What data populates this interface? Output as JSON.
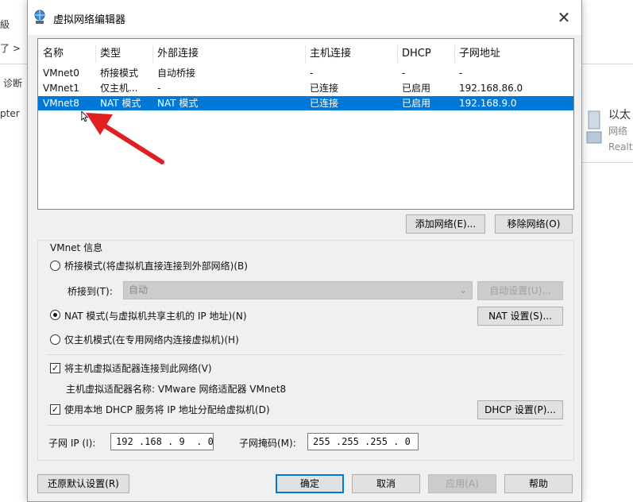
{
  "background": {
    "frag1": "級",
    "frag2": "了 >",
    "frag3": "诊断",
    "frag4": "pter",
    "frag5": "以太",
    "frag6": "网络",
    "frag7": "Realt"
  },
  "window": {
    "title": "虚拟网络编辑器",
    "close": "✕"
  },
  "network_list": {
    "columns": [
      "名称",
      "类型",
      "外部连接",
      "主机连接",
      "DHCP",
      "子网地址"
    ],
    "rows": [
      [
        "VMnet0",
        "桥接模式",
        "自动桥接",
        "-",
        "-",
        "-"
      ],
      [
        "VMnet1",
        "仅主机...",
        "-",
        "已连接",
        "已启用",
        "192.168.86.0"
      ],
      [
        "VMnet8",
        "NAT 模式",
        "NAT 模式",
        "已连接",
        "已启用",
        "192.168.9.0"
      ]
    ],
    "selected_index": 2
  },
  "list_buttons": {
    "add": "添加网络(E)...",
    "remove": "移除网络(O)"
  },
  "vmnet_info": {
    "title": "VMnet 信息",
    "bridged_label": "桥接模式(将虚拟机直接连接到外部网络)(B)",
    "bridge_to_label": "桥接到(T):",
    "bridge_to_value": "自动",
    "auto_settings": "自动设置(U)...",
    "nat_label": "NAT 模式(与虚拟机共享主机的 IP 地址)(N)",
    "nat_settings": "NAT 设置(S)...",
    "hostonly_label": "仅主机模式(在专用网络内连接虚拟机)(H)",
    "connect_adapter_label": "将主机虚拟适配器连接到此网络(V)",
    "adapter_name_label": "主机虚拟适配器名称: VMware 网络适配器 VMnet8",
    "dhcp_label": "使用本地 DHCP 服务将 IP 地址分配给虚拟机(D)",
    "dhcp_settings": "DHCP 设置(P)...",
    "subnet_ip_label": "子网 IP (I):",
    "subnet_ip_value": "192 .168 . 9  . 0",
    "subnet_mask_label": "子网掩码(M):",
    "subnet_mask_value": "255 .255 .255 . 0",
    "selected_mode": "nat",
    "connect_adapter_checked": true,
    "dhcp_checked": true
  },
  "footer": {
    "restore": "还原默认设置(R)",
    "ok": "确定",
    "cancel": "取消",
    "apply": "应用(A)",
    "help": "帮助"
  },
  "colors": {
    "selection": "#0078d7",
    "annotation_arrow": "#e02020"
  }
}
